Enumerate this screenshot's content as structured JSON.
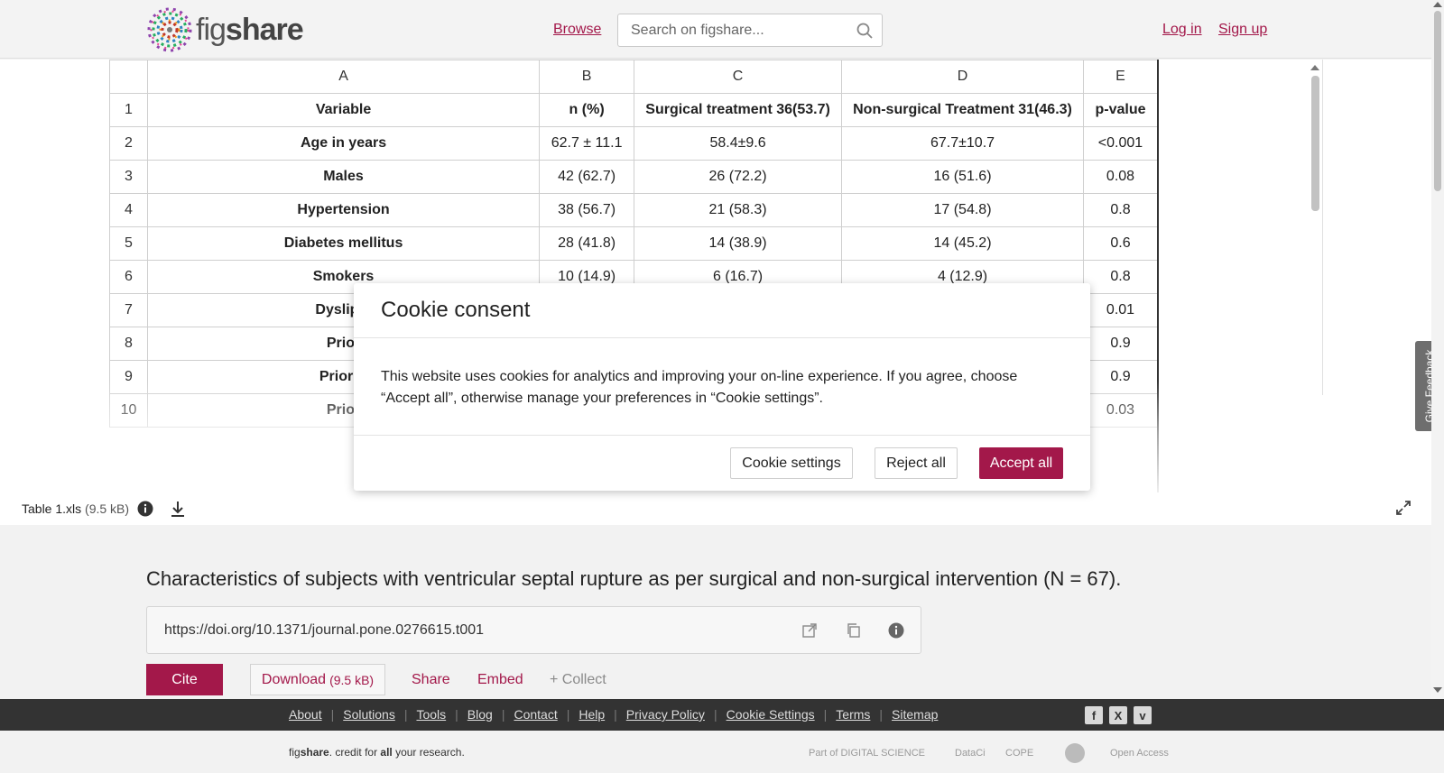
{
  "brand": {
    "logo_text_light": "fig",
    "logo_text_bold": "share",
    "accent": "#a3184a"
  },
  "header": {
    "browse_label": "Browse",
    "search_placeholder": "Search on figshare...",
    "login_label": "Log in",
    "signup_label": "Sign up"
  },
  "sheet": {
    "columns": [
      "",
      "A",
      "B",
      "C",
      "D",
      "E"
    ],
    "rows": [
      [
        "1",
        "Variable",
        "n (%)",
        "Surgical treatment 36(53.7)",
        "Non-surgical Treatment 31(46.3)",
        "p-value"
      ],
      [
        "2",
        "Age in years",
        "62.7 ± 11.1",
        "58.4±9.6",
        "67.7±10.7",
        "<0.001"
      ],
      [
        "3",
        "Males",
        "42 (62.7)",
        "26 (72.2)",
        "16 (51.6)",
        "0.08"
      ],
      [
        "4",
        "Hypertension",
        "38 (56.7)",
        "21 (58.3)",
        "17 (54.8)",
        "0.8"
      ],
      [
        "5",
        "Diabetes mellitus",
        "28 (41.8)",
        "14 (38.9)",
        "14 (45.2)",
        "0.6"
      ],
      [
        "6",
        "Smokers",
        "10 (14.9)",
        "6 (16.7)",
        "4 (12.9)",
        "0.8"
      ],
      [
        "7",
        "Dyslipid",
        "",
        "",
        "",
        "0.01"
      ],
      [
        "8",
        "Prior",
        "",
        "",
        "",
        "0.9"
      ],
      [
        "9",
        "Prior C",
        "",
        "",
        "",
        "0.9"
      ],
      [
        "10",
        "Prior",
        "",
        "",
        "",
        "0.03"
      ]
    ]
  },
  "file": {
    "name": "Table 1.xls",
    "size": "(9.5 kB)"
  },
  "feedback_label": "Give Feedback",
  "item": {
    "title": "Characteristics of subjects with ventricular septal rupture as per surgical and non-surgical intervention (N = 67).",
    "doi": "https://doi.org/10.1371/journal.pone.0276615.t001",
    "cite_label": "Cite",
    "download_label": "Download",
    "download_size": "(9.5 kB)",
    "share_label": "Share",
    "embed_label": "Embed",
    "collect_label": "+ Collect"
  },
  "footer": {
    "links": [
      "About",
      "Solutions",
      "Tools",
      "Blog",
      "Contact",
      "Help",
      "Privacy Policy",
      "Cookie Settings",
      "Terms",
      "Sitemap"
    ],
    "credit_light1": "fig",
    "credit_bold": "share",
    "credit_rest1": ". credit for ",
    "credit_all": "all",
    "credit_rest2": " your research.",
    "partners": [
      "Part of DIGITAL SCIENCE",
      "DataCite",
      "COPE",
      "Open Access"
    ]
  },
  "cookie": {
    "title": "Cookie consent",
    "body": "This website uses cookies for analytics and improving your on-line experience. If you agree, choose “Accept all”, otherwise manage your preferences in “Cookie settings”.",
    "settings_label": "Cookie settings",
    "reject_label": "Reject all",
    "accept_label": "Accept all"
  }
}
